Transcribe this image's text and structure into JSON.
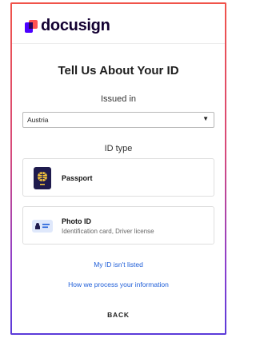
{
  "brand": {
    "name": "docusign",
    "accent": "#4c00ff",
    "secondary": "#ff5252"
  },
  "page": {
    "title": "Tell Us About Your ID"
  },
  "issued_in": {
    "label": "Issued in",
    "selected": "Austria",
    "caret_icon": "triangle-down"
  },
  "id_type": {
    "label": "ID type",
    "options": [
      {
        "name": "Passport",
        "description": "",
        "icon": "passport-icon"
      },
      {
        "name": "Photo ID",
        "description": "Identification card, Driver license",
        "icon": "id-card-icon"
      }
    ]
  },
  "links": {
    "not_listed": "My ID isn't listed",
    "process": "How we process your information",
    "color": "#1f5ed8"
  },
  "back": {
    "label": "BACK"
  }
}
